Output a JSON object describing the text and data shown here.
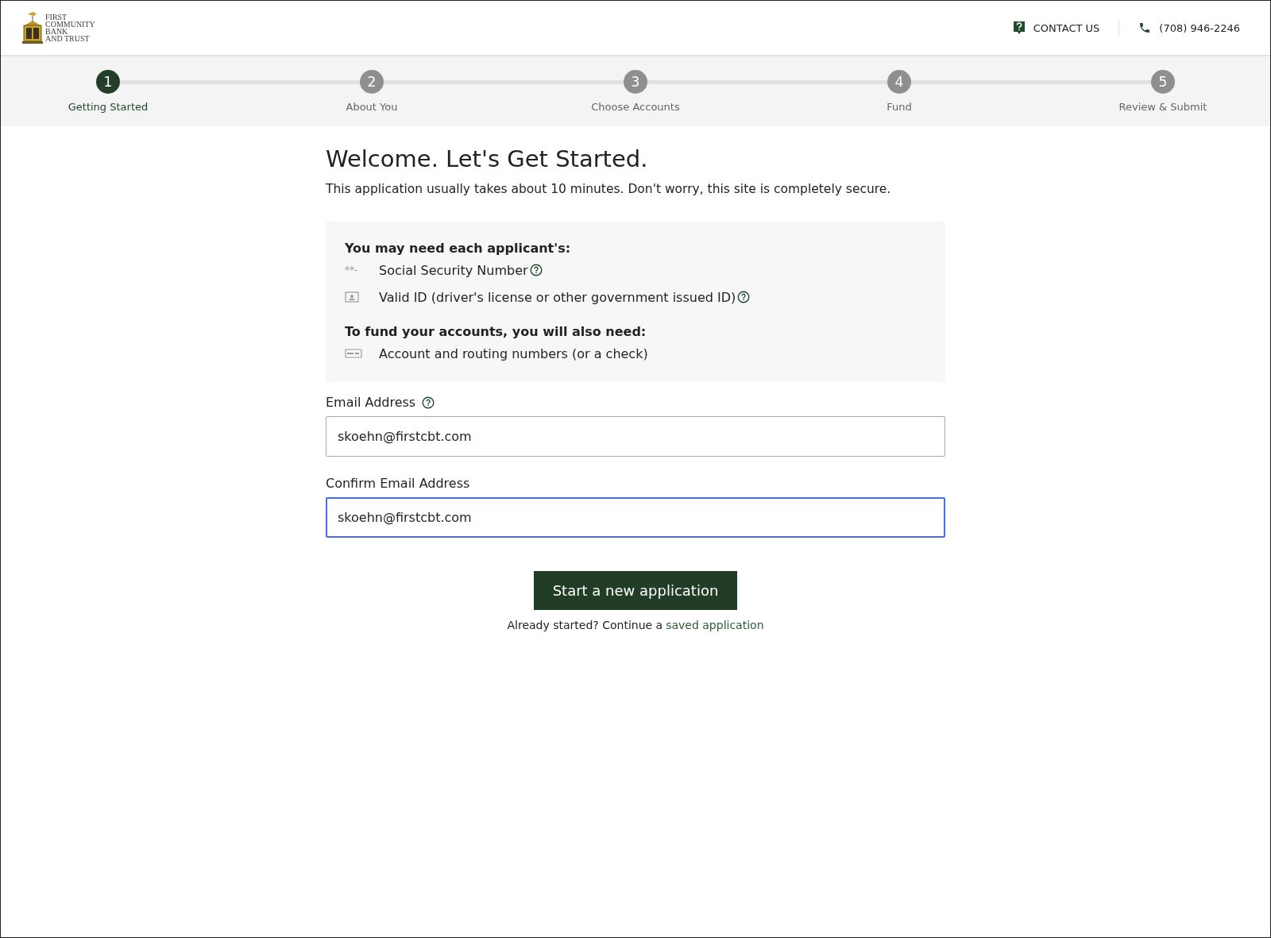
{
  "logo": {
    "lines": [
      "FIRST",
      "COMMUNITY",
      "BANK",
      "AND TRUST"
    ]
  },
  "header": {
    "contact": "CONTACT US",
    "phone": "(708) 946-2246"
  },
  "steps": [
    {
      "number": "1",
      "label": "Getting Started",
      "selected": true
    },
    {
      "number": "2",
      "label": "About You",
      "selected": false
    },
    {
      "number": "3",
      "label": "Choose Accounts",
      "selected": false
    },
    {
      "number": "4",
      "label": "Fund",
      "selected": false
    },
    {
      "number": "5",
      "label": "Review & Submit",
      "selected": false
    }
  ],
  "title": "Welcome. Let's Get Started.",
  "subtitle": "This application usually takes about 10 minutes. Don't worry, this site is completely secure.",
  "requirements": [
    {
      "heading": "You may need each applicant's:",
      "items": [
        {
          "kind": "ssn",
          "glyph": "**-",
          "text": "Social Security Number",
          "help": true
        },
        {
          "kind": "id",
          "text": "Valid ID (driver's license or other government issued ID)",
          "help": true
        }
      ]
    },
    {
      "heading": "To fund your accounts, you will also need:",
      "items": [
        {
          "kind": "check",
          "text": "Account and routing numbers (or a check)",
          "help": false
        }
      ]
    }
  ],
  "fields": [
    {
      "label": "Email Address",
      "help": true,
      "value": "skoehn@firstcbt.com",
      "focused": false
    },
    {
      "label": "Confirm Email Address",
      "help": false,
      "value": "skoehn@firstcbt.com",
      "focused": true
    }
  ],
  "button": "Start a new application",
  "footer": {
    "text": "Already started? Continue a",
    "link": "saved application"
  }
}
